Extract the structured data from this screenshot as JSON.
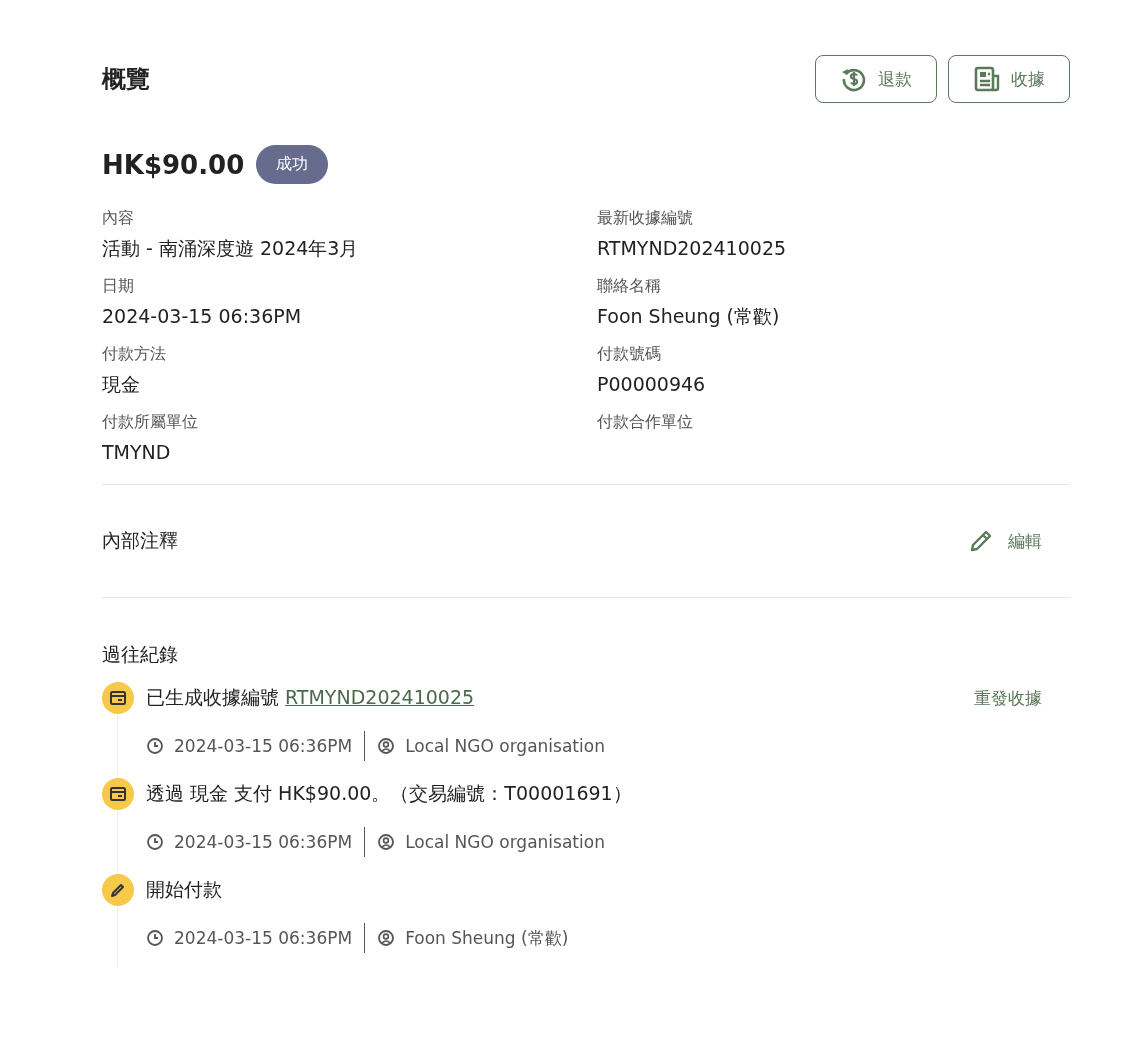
{
  "header": {
    "title": "概覽",
    "buttons": [
      {
        "kind": "refund",
        "label": "退款"
      },
      {
        "kind": "receipt",
        "label": "收據"
      }
    ]
  },
  "amount": "HK$90.00",
  "status": "成功",
  "fields": [
    {
      "label": "內容",
      "value": "活動 - 南涌深度遊 2024年3月"
    },
    {
      "label": "最新收據編號",
      "value": "RTMYND202410025"
    },
    {
      "label": "日期",
      "value": "2024-03-15 06:36PM"
    },
    {
      "label": "聯絡名稱",
      "value": "Foon Sheung (常歡)"
    },
    {
      "label": "付款方法",
      "value": "現金"
    },
    {
      "label": "付款號碼",
      "value": "P00000946"
    },
    {
      "label": "付款所屬單位",
      "value": "TMYND"
    },
    {
      "label": "付款合作單位"
    }
  ],
  "notes": {
    "title": "內部注釋",
    "edit": "編輯"
  },
  "history": {
    "title": "過往紀錄",
    "items": [
      {
        "kind": "receipt",
        "text": "已生成收據編號",
        "link": "RTMYND202410025",
        "action": "重發收據",
        "time": "2024-03-15 06:36PM",
        "user": "Local NGO organisation"
      },
      {
        "kind": "receipt",
        "text": "透過 現金 支付 HK$90.00。（交易編號：T00001691）",
        "time": "2024-03-15 06:36PM",
        "user": "Local NGO organisation"
      },
      {
        "kind": "edit",
        "text": "開始付款",
        "time": "2024-03-15 06:36PM",
        "user": "Foon Sheung (常歡)"
      }
    ]
  }
}
